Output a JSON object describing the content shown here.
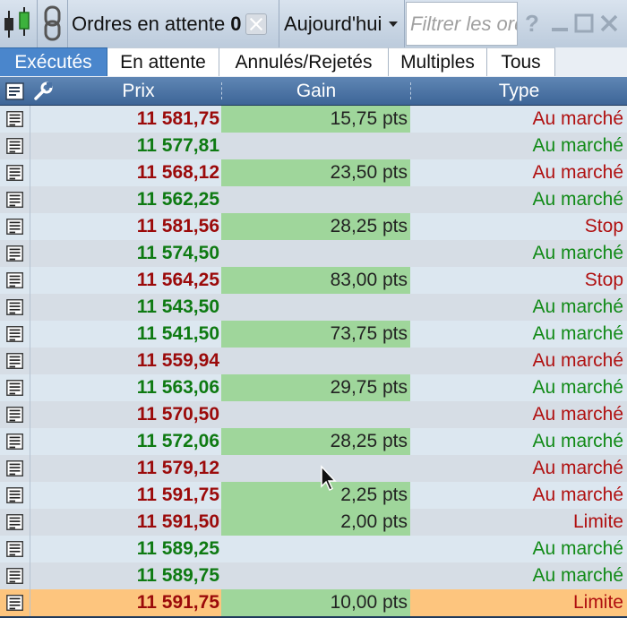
{
  "toolbar": {
    "title": "Ordres en attente",
    "pending_count": "0",
    "period": "Aujourd'hui",
    "filter_placeholder": "Filtrer les ordres",
    "help": "?"
  },
  "tabs": [
    {
      "label": "Exécutés",
      "active": true
    },
    {
      "label": "En attente",
      "active": false
    },
    {
      "label": "Annulés/Rejetés",
      "active": false
    },
    {
      "label": "Multiples",
      "active": false
    },
    {
      "label": "Tous",
      "active": false
    }
  ],
  "columns": {
    "price": "Prix",
    "gain": "Gain",
    "type": "Type"
  },
  "colors": {
    "price_red": "#9b0a0a",
    "price_green": "#0e7a12",
    "gain_fill": "#9fd69b",
    "selected_row": "#fdc57e",
    "tab_active": "#4a86cc",
    "header": "#4a72a4"
  },
  "icons": {
    "toolbar_left": "candlestick-chart-icon",
    "toolbar_link": "chain-link-icon",
    "header_doc": "document-icon",
    "header_settings": "wrench-icon",
    "row": "document-icon"
  },
  "rows": [
    {
      "price": "11 581,75",
      "price_color": "red",
      "gain": "15,75 pts",
      "type": "Au marché",
      "type_color": "red"
    },
    {
      "price": "11 577,81",
      "price_color": "green",
      "gain": "",
      "type": "Au marché",
      "type_color": "green"
    },
    {
      "price": "11 568,12",
      "price_color": "red",
      "gain": "23,50 pts",
      "type": "Au marché",
      "type_color": "red"
    },
    {
      "price": "11 562,25",
      "price_color": "green",
      "gain": "",
      "type": "Au marché",
      "type_color": "green"
    },
    {
      "price": "11 581,56",
      "price_color": "red",
      "gain": "28,25 pts",
      "type": "Stop",
      "type_color": "red"
    },
    {
      "price": "11 574,50",
      "price_color": "green",
      "gain": "",
      "type": "Au marché",
      "type_color": "green"
    },
    {
      "price": "11 564,25",
      "price_color": "red",
      "gain": "83,00 pts",
      "type": "Stop",
      "type_color": "red"
    },
    {
      "price": "11 543,50",
      "price_color": "green",
      "gain": "",
      "type": "Au marché",
      "type_color": "green"
    },
    {
      "price": "11 541,50",
      "price_color": "green",
      "gain": "73,75 pts",
      "type": "Au marché",
      "type_color": "green"
    },
    {
      "price": "11 559,94",
      "price_color": "red",
      "gain": "",
      "type": "Au marché",
      "type_color": "red"
    },
    {
      "price": "11 563,06",
      "price_color": "green",
      "gain": "29,75 pts",
      "type": "Au marché",
      "type_color": "green"
    },
    {
      "price": "11 570,50",
      "price_color": "red",
      "gain": "",
      "type": "Au marché",
      "type_color": "red"
    },
    {
      "price": "11 572,06",
      "price_color": "green",
      "gain": "28,25 pts",
      "type": "Au marché",
      "type_color": "green"
    },
    {
      "price": "11 579,12",
      "price_color": "red",
      "gain": "",
      "type": "Au marché",
      "type_color": "red"
    },
    {
      "price": "11 591,75",
      "price_color": "red",
      "gain": "2,25 pts",
      "type": "Au marché",
      "type_color": "red"
    },
    {
      "price": "11 591,50",
      "price_color": "red",
      "gain": "2,00 pts",
      "type": "Limite",
      "type_color": "red"
    },
    {
      "price": "11 589,25",
      "price_color": "green",
      "gain": "",
      "type": "Au marché",
      "type_color": "green"
    },
    {
      "price": "11 589,75",
      "price_color": "green",
      "gain": "",
      "type": "Au marché",
      "type_color": "green"
    },
    {
      "price": "11 591,75",
      "price_color": "red",
      "gain": "10,00 pts",
      "type": "Limite",
      "type_color": "red",
      "selected": true
    }
  ]
}
